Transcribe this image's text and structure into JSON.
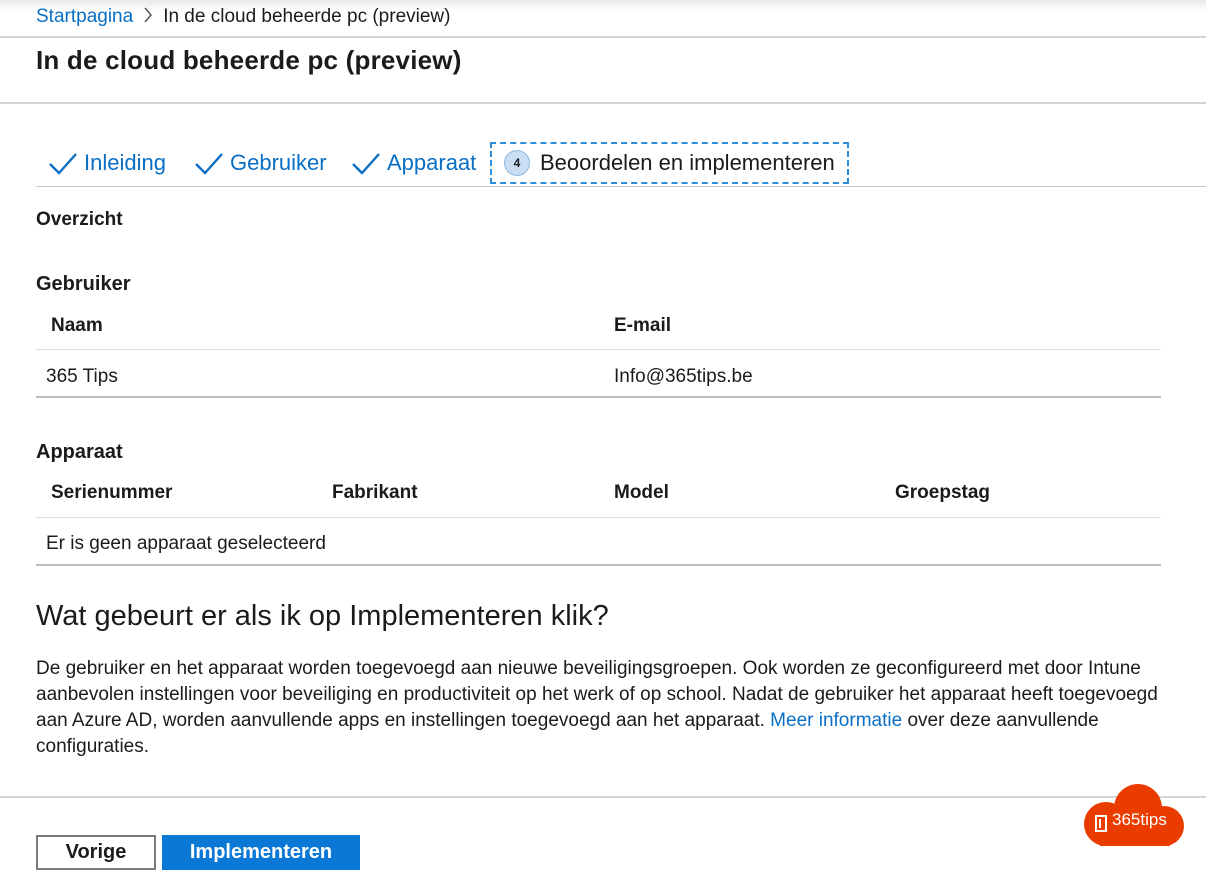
{
  "breadcrumb": {
    "home": "Startpagina",
    "current": "In de cloud beheerde pc (preview)"
  },
  "page": {
    "title": "In de cloud beheerde pc (preview)"
  },
  "tabs": [
    {
      "label": "Inleiding",
      "state": "done"
    },
    {
      "label": "Gebruiker",
      "state": "done"
    },
    {
      "label": "Apparaat",
      "state": "done"
    },
    {
      "label": "Beoordelen en implementeren",
      "state": "active",
      "step": "4"
    }
  ],
  "overview": {
    "label": "Overzicht"
  },
  "user_section": {
    "label": "Gebruiker",
    "columns": [
      "Naam",
      "E-mail"
    ],
    "rows": [
      [
        "365 Tips",
        "Info@365tips.be"
      ]
    ]
  },
  "device_section": {
    "label": "Apparaat",
    "columns": [
      "Serienummer",
      "Fabrikant",
      "Model",
      "Groepstag"
    ],
    "empty_text": "Er is geen apparaat geselecteerd"
  },
  "info": {
    "question": "Wat gebeurt er als ik op Implementeren klik?",
    "text_before": "De gebruiker en het apparaat worden toegevoegd aan nieuwe beveiligingsgroepen. Ook worden ze geconfigureerd met door Intune aanbevolen instellingen voor beveiliging en productiviteit op het werk of op school. Nadat de gebruiker het apparaat heeft toegevoegd aan Azure AD, worden aanvullende apps en instellingen toegevoegd aan het apparaat. ",
    "link": "Meer informatie",
    "text_after": " over deze aanvullende configuraties."
  },
  "buttons": {
    "previous": "Vorige",
    "deploy": "Implementeren"
  },
  "watermark": {
    "text": "365tips"
  },
  "colors": {
    "accent": "#0a78d4",
    "link": "#0a6fc4",
    "logo": "#eb3c00"
  }
}
